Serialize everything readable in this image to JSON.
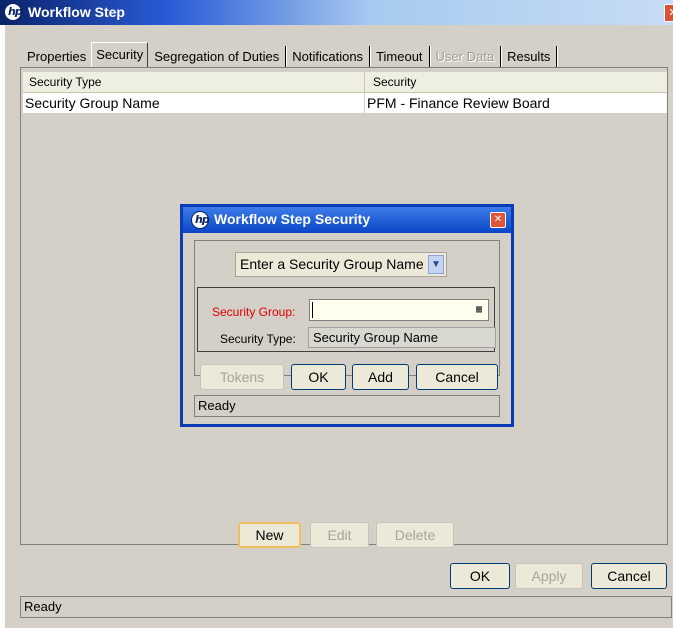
{
  "window": {
    "title": "Workflow Step",
    "close_glyph": "✕"
  },
  "tabs": [
    {
      "label": "Properties",
      "state": "normal"
    },
    {
      "label": "Security",
      "state": "active"
    },
    {
      "label": "Segregation of Duties",
      "state": "normal"
    },
    {
      "label": "Notifications",
      "state": "normal"
    },
    {
      "label": "Timeout",
      "state": "normal"
    },
    {
      "label": "User Data",
      "state": "disabled"
    },
    {
      "label": "Results",
      "state": "normal"
    }
  ],
  "table": {
    "columns": [
      "Security Type",
      "Security"
    ],
    "rows": [
      [
        "Security Group Name",
        "PFM - Finance Review Board"
      ]
    ]
  },
  "panel_buttons": {
    "new": "New",
    "edit": "Edit",
    "delete": "Delete"
  },
  "dialog_buttons": {
    "ok": "OK",
    "apply": "Apply",
    "cancel": "Cancel"
  },
  "status": "Ready",
  "modal": {
    "title": "Workflow Step Security",
    "selector_value": "Enter a Security Group Name",
    "security_group_label": "Security Group:",
    "security_group_value": "",
    "security_type_label": "Security Type:",
    "security_type_value": "Security Group Name",
    "buttons": {
      "tokens": "Tokens",
      "ok": "OK",
      "add": "Add",
      "cancel": "Cancel"
    },
    "status": "Ready"
  },
  "colors": {
    "titlebar": "#0a246a",
    "modal_titlebar": "#0a46c8",
    "required_label": "#e00000",
    "surface": "#d4d0c8"
  },
  "icons": [
    "hp-logo-icon",
    "close-icon",
    "chevron-down-icon",
    "lookup-list-icon"
  ]
}
